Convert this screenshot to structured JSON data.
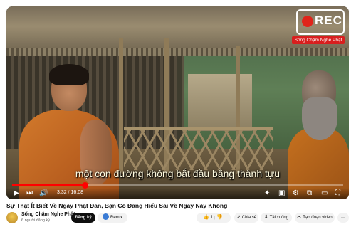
{
  "video": {
    "subtitle": "một con đường không bắt đầu bằng thành tựu",
    "current_time": "3:32",
    "duration": "16:08",
    "progress": 0.219,
    "rec_label": "REC",
    "rec_channel": "Sống Chậm Nghe Phật"
  },
  "title": "Sự Thật Ít Biết Về Ngày Phật Đản, Bạn Có Đang Hiểu Sai Về Ngày Này Không",
  "channel": {
    "name": "Sống Chậm Nghe Phật",
    "subscribers": "6 người đăng ký"
  },
  "actions": {
    "subscribe": "Đăng ký",
    "remix": "Remix",
    "likes": "1",
    "share": "Chia sẻ",
    "download": "Tải xuống",
    "clip": "Tạo đoạn video",
    "more": "···"
  },
  "icons": {
    "play": "play-icon",
    "next": "next-icon",
    "volume": "volume-icon",
    "settings": "gear-icon",
    "captions": "captions-icon",
    "miniplayer": "miniplayer-icon",
    "theater": "theater-icon",
    "fullscreen": "fullscreen-icon"
  },
  "colors": {
    "accent_red": "#ff0000",
    "rec_red": "#d81e1e"
  }
}
